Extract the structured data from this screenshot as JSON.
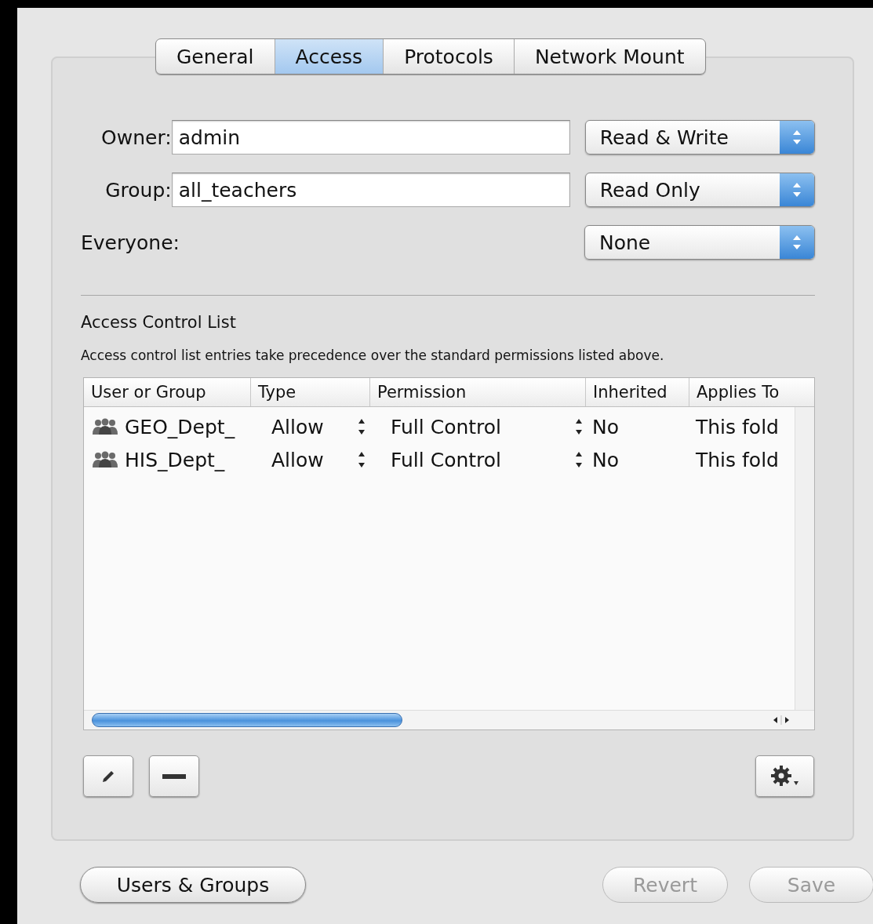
{
  "tabs": [
    {
      "label": "General",
      "selected": false
    },
    {
      "label": "Access",
      "selected": true
    },
    {
      "label": "Protocols",
      "selected": false
    },
    {
      "label": "Network Mount",
      "selected": false
    }
  ],
  "permissions": [
    {
      "label": "Owner:",
      "value": "admin",
      "access": "Read & Write",
      "kind": "field"
    },
    {
      "label": "Group:",
      "value": "all_teachers",
      "access": "Read Only",
      "kind": "field"
    },
    {
      "label": "Everyone:",
      "access": "None",
      "kind": "plain"
    }
  ],
  "acl": {
    "title": "Access Control List",
    "description": "Access control list entries take precedence over the standard permissions listed above.",
    "columns": [
      "User or Group",
      "Type",
      "Permission",
      "Inherited",
      "Applies To"
    ],
    "rows": [
      {
        "user": "GEO_Dept_",
        "type": "Allow",
        "permission": "Full Control",
        "inherited": "No",
        "applies_to": "This fold"
      },
      {
        "user": "HIS_Dept_",
        "type": "Allow",
        "permission": "Full Control",
        "inherited": "No",
        "applies_to": "This fold"
      }
    ]
  },
  "buttons": [
    {
      "label": "Users & Groups",
      "disabled": false
    },
    {
      "label": "Revert",
      "disabled": true
    },
    {
      "label": "Save",
      "disabled": true
    }
  ]
}
